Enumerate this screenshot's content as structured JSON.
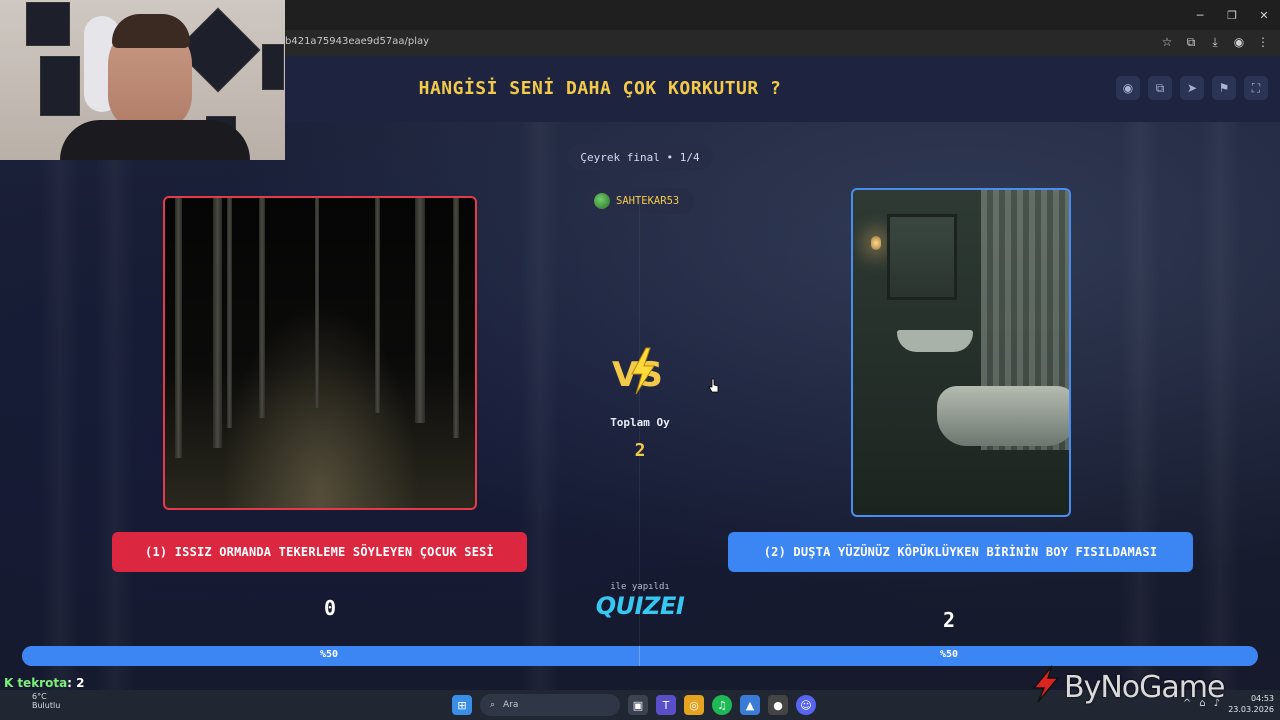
{
  "browser": {
    "url": "b421a75943eae9d57aa/play",
    "window_controls": [
      "─",
      "❐",
      "✕"
    ],
    "address_icons": [
      "☆",
      "⧉",
      "⤓",
      "◉",
      "⋮"
    ]
  },
  "header": {
    "title": "HANGİSİ SENİ DAHA ÇOK KORKUTUR ?",
    "buttons": [
      "eye-icon",
      "copy-icon",
      "send-icon",
      "flag-icon",
      "fullscreen-icon"
    ]
  },
  "round": {
    "label": "Çeyrek final • 1/4"
  },
  "player": {
    "name": "SAHTEKAR53"
  },
  "center": {
    "vs_text": "VS",
    "total_label": "Toplam Oy",
    "total_votes": "2"
  },
  "options": [
    {
      "label": "(1) ISSIZ ORMANDA TEKERLEME SÖYLEYEN ÇOCUK SESİ",
      "votes": "0",
      "percent_label": "%50",
      "color": "#dc2741"
    },
    {
      "label": "(2) DUŞTA YÜZÜNÜZ KÖPÜKLÜYKEN BİRİNİN BOY FISILDAMASI",
      "votes": "2",
      "percent_label": "%50",
      "color": "#3b86f3"
    }
  ],
  "progress": {
    "left_fraction": 0.5,
    "accent": "#3b86f3"
  },
  "footer": {
    "made_with": "ile yapıldı",
    "brand": "QUIZEI"
  },
  "chat": {
    "user": "tekrota",
    "message": ": 2"
  },
  "taskbar": {
    "weather_temp": "6°C",
    "weather_desc": "Bulutlu",
    "search_placeholder": "Ara",
    "time": "04:53",
    "date": "23.03.2026"
  },
  "watermark": {
    "text": "ByNoGame"
  }
}
